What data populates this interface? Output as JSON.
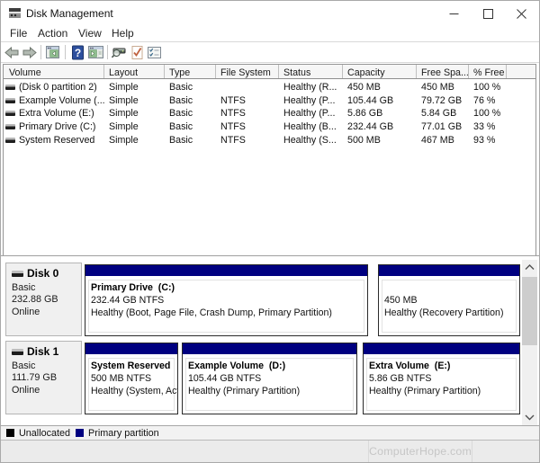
{
  "window": {
    "title": "Disk Management",
    "controls": {
      "minimize": "minimize",
      "maximize": "maximize",
      "close": "close"
    }
  },
  "menu": {
    "items": [
      {
        "label": "File"
      },
      {
        "label": "Action"
      },
      {
        "label": "View"
      },
      {
        "label": "Help"
      }
    ]
  },
  "toolbar": {
    "icons": [
      "back-arrow",
      "forward-arrow",
      "show-console-tree",
      "help",
      "show-window",
      "rescan-disks",
      "check-document",
      "properties-list"
    ]
  },
  "table": {
    "columns": [
      "Volume",
      "Layout",
      "Type",
      "File System",
      "Status",
      "Capacity",
      "Free Spa...",
      "% Free"
    ],
    "rows": [
      {
        "name": "(Disk 0 partition 2)",
        "layout": "Simple",
        "type": "Basic",
        "fs": "",
        "status": "Healthy (R...",
        "capacity": "450 MB",
        "free": "450 MB",
        "pct": "100 %"
      },
      {
        "name": "Example Volume (...",
        "layout": "Simple",
        "type": "Basic",
        "fs": "NTFS",
        "status": "Healthy (P...",
        "capacity": "105.44 GB",
        "free": "79.72 GB",
        "pct": "76 %"
      },
      {
        "name": "Extra Volume (E:)",
        "layout": "Simple",
        "type": "Basic",
        "fs": "NTFS",
        "status": "Healthy (P...",
        "capacity": "5.86 GB",
        "free": "5.84 GB",
        "pct": "100 %"
      },
      {
        "name": "Primary Drive (C:)",
        "layout": "Simple",
        "type": "Basic",
        "fs": "NTFS",
        "status": "Healthy (B...",
        "capacity": "232.44 GB",
        "free": "77.01 GB",
        "pct": "33 %"
      },
      {
        "name": "System Reserved",
        "layout": "Simple",
        "type": "Basic",
        "fs": "NTFS",
        "status": "Healthy (S...",
        "capacity": "500 MB",
        "free": "467 MB",
        "pct": "93 %"
      }
    ]
  },
  "disks": [
    {
      "label": "Disk 0",
      "type": "Basic",
      "size": "232.88 GB",
      "status": "Online",
      "partitions": [
        {
          "name": "Primary Drive  (C:)",
          "size": "232.44 GB NTFS",
          "status": "Healthy (Boot, Page File, Crash Dump, Primary Partition)"
        },
        {
          "name": "",
          "size": "450 MB",
          "status": "Healthy (Recovery Partition)"
        }
      ]
    },
    {
      "label": "Disk 1",
      "type": "Basic",
      "size": "111.79 GB",
      "status": "Online",
      "partitions": [
        {
          "name": "System Reserved",
          "size": "500 MB NTFS",
          "status": "Healthy (System, Act"
        },
        {
          "name": "Example Volume  (D:)",
          "size": "105.44 GB NTFS",
          "status": "Healthy (Primary Partition)"
        },
        {
          "name": "Extra Volume  (E:)",
          "size": "5.86 GB NTFS",
          "status": "Healthy (Primary Partition)"
        }
      ]
    }
  ],
  "legend": {
    "items": [
      {
        "label": "Unallocated",
        "color": "#000000"
      },
      {
        "label": "Primary partition",
        "color": "#000080"
      }
    ]
  },
  "watermark": "ComputerHope.com",
  "colors": {
    "partition_band": "#000080",
    "unallocated": "#000000"
  }
}
